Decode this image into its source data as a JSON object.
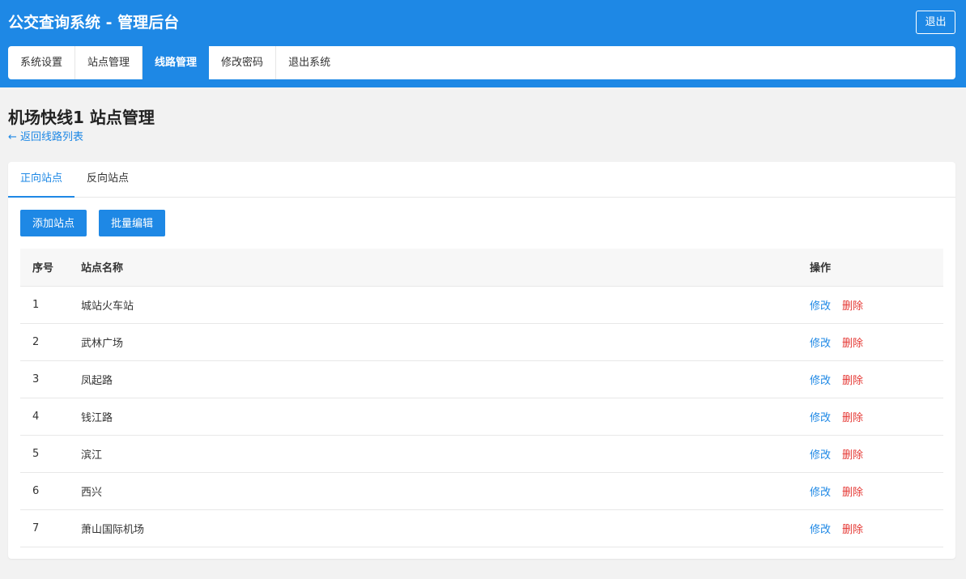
{
  "header": {
    "title": "公交查询系统 - 管理后台",
    "logout_label": "退出"
  },
  "nav": {
    "items": [
      {
        "label": "系统设置"
      },
      {
        "label": "站点管理"
      },
      {
        "label": "线路管理",
        "active": true
      },
      {
        "label": "修改密码"
      },
      {
        "label": "退出系统"
      }
    ]
  },
  "page": {
    "title": "机场快线1 站点管理",
    "back_link": "← 返回线路列表"
  },
  "tabs": [
    {
      "label": "正向站点",
      "active": true
    },
    {
      "label": "反向站点"
    }
  ],
  "toolbar": {
    "add_label": "添加站点",
    "batch_label": "批量编辑"
  },
  "table": {
    "headers": {
      "index": "序号",
      "name": "站点名称",
      "actions": "操作"
    },
    "edit_label": "修改",
    "delete_label": "删除",
    "rows": [
      {
        "index": "1",
        "name": "城站火车站"
      },
      {
        "index": "2",
        "name": "武林广场"
      },
      {
        "index": "3",
        "name": "凤起路"
      },
      {
        "index": "4",
        "name": "钱江路"
      },
      {
        "index": "5",
        "name": "滨江"
      },
      {
        "index": "6",
        "name": "西兴"
      },
      {
        "index": "7",
        "name": "萧山国际机场"
      }
    ]
  },
  "colors": {
    "primary": "#1e88e5",
    "danger": "#e53935",
    "background": "#f2f2f2"
  }
}
